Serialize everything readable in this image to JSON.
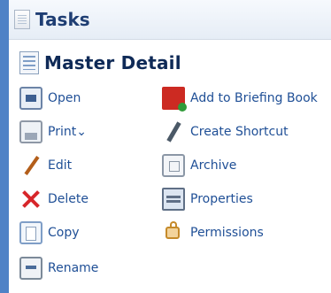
{
  "header": {
    "title": "Tasks",
    "icon": "tasks-icon"
  },
  "section": {
    "title": "Master Detail",
    "icon": "master-detail-icon"
  },
  "tasks_left": [
    {
      "label": "Open",
      "icon": "open-icon"
    },
    {
      "label": "Print ",
      "icon": "print-icon"
    },
    {
      "label": "Edit",
      "icon": "edit-icon"
    },
    {
      "label": "Delete",
      "icon": "delete-icon"
    },
    {
      "label": "Copy",
      "icon": "copy-icon"
    },
    {
      "label": "Rename",
      "icon": "rename-icon"
    }
  ],
  "tasks_right": [
    {
      "label": "Add to Briefing Book",
      "icon": "briefing-book-icon"
    },
    {
      "label": "Create Shortcut",
      "icon": "create-shortcut-icon"
    },
    {
      "label": "Archive",
      "icon": "archive-icon"
    },
    {
      "label": "Properties",
      "icon": "properties-icon"
    },
    {
      "label": "Permissions",
      "icon": "permissions-icon"
    }
  ],
  "colors": {
    "sidebar_accent": "#4f82c6",
    "link_text": "#1f4f96",
    "title_text": "#0f2a57"
  }
}
